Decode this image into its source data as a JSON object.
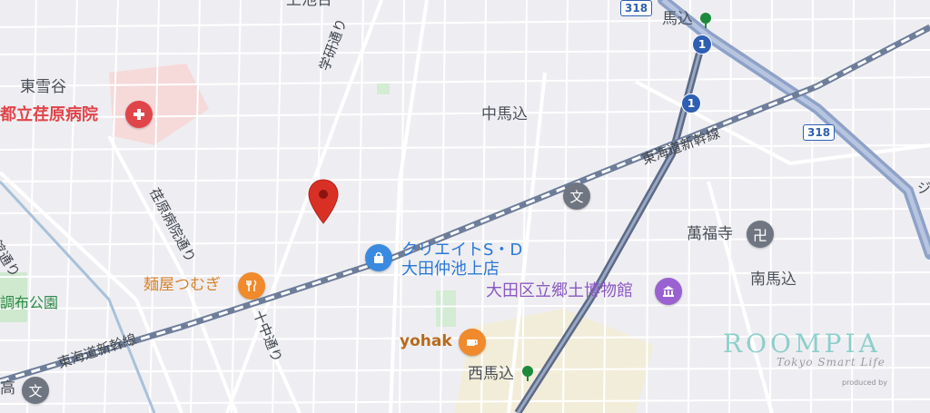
{
  "map": {
    "area_labels": [
      "東雪谷",
      "中馬込",
      "南馬込",
      "馬込",
      "西馬込",
      "上池台"
    ],
    "road_labels": [
      "学研通り",
      "荏原病院通り",
      "東海道新幹線",
      "東海道新幹線",
      "十中通り",
      "館通り"
    ],
    "poi_labels": {
      "hospital": "都立荏原病院",
      "ramen": "麺屋つむぎ",
      "store": "クリエイトS・D\n大田仲池上店",
      "museum": "大田区立郷土博物館",
      "cafe": "yohak",
      "temple": "萬福寺",
      "park": "調布公園"
    },
    "route_numbers": [
      "318",
      "318",
      "1",
      "1"
    ],
    "partial_labels": [
      "高",
      "ジ"
    ],
    "watermark": {
      "brand": "ROOMPIA",
      "tagline": "Tokyo Smart Life",
      "credit": "produced by"
    },
    "icons": {
      "hospital": "hospital-cross-icon",
      "ramen": "fork-knife-icon",
      "store": "shopping-bag-icon",
      "museum": "museum-icon",
      "cafe": "coffee-cup-icon",
      "temple": "manji-icon",
      "school": "school-icon",
      "station": "train-station-icon",
      "pin": "location-pin-icon"
    },
    "colors": {
      "background": "#eeeef2",
      "streets": "#ffffff",
      "rail": "#7a8aa8",
      "shinkansen": "#6aa8a0",
      "expressway": "#8ea2c8",
      "pin": "#d93025",
      "hospital_area": "#f7d6d6",
      "park": "#c9e8c9"
    }
  }
}
